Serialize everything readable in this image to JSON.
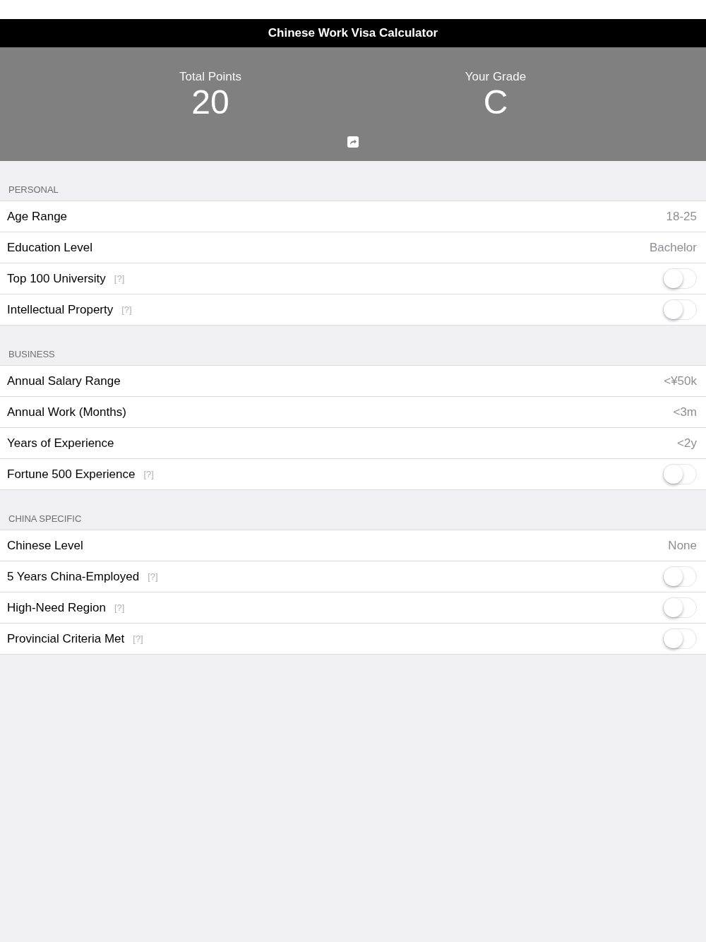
{
  "nav_bar": {
    "title": "Chinese Work Visa Calculator"
  },
  "summary": {
    "stats": [
      {
        "label": "Total Points",
        "value": "20"
      },
      {
        "label": "Your Grade",
        "value": "C"
      }
    ]
  },
  "sections": [
    {
      "header": "PERSONAL",
      "rows": [
        {
          "kind": "value",
          "label": "Age Range",
          "value": "18-25"
        },
        {
          "kind": "value",
          "label": "Education Level",
          "value": "Bachelor"
        },
        {
          "kind": "toggle",
          "label": "Top 100 University",
          "help": "[?]",
          "on": false
        },
        {
          "kind": "toggle",
          "label": "Intellectual Property",
          "help": "[?]",
          "on": false
        }
      ]
    },
    {
      "header": "BUSINESS",
      "rows": [
        {
          "kind": "value",
          "label": "Annual Salary Range",
          "value": "<¥50k"
        },
        {
          "kind": "value",
          "label": "Annual Work (Months)",
          "value": "<3m"
        },
        {
          "kind": "value",
          "label": "Years of Experience",
          "value": "<2y"
        },
        {
          "kind": "toggle",
          "label": "Fortune 500 Experience",
          "help": "[?]",
          "on": false
        }
      ]
    },
    {
      "header": "CHINA SPECIFIC",
      "rows": [
        {
          "kind": "value",
          "label": "Chinese Level",
          "value": "None"
        },
        {
          "kind": "toggle",
          "label": "5 Years China-Employed",
          "help": "[?]",
          "on": false
        },
        {
          "kind": "toggle",
          "label": "High-Need Region",
          "help": "[?]",
          "on": false
        },
        {
          "kind": "toggle",
          "label": "Provincial Criteria Met",
          "help": "[?]",
          "on": false
        }
      ]
    }
  ]
}
